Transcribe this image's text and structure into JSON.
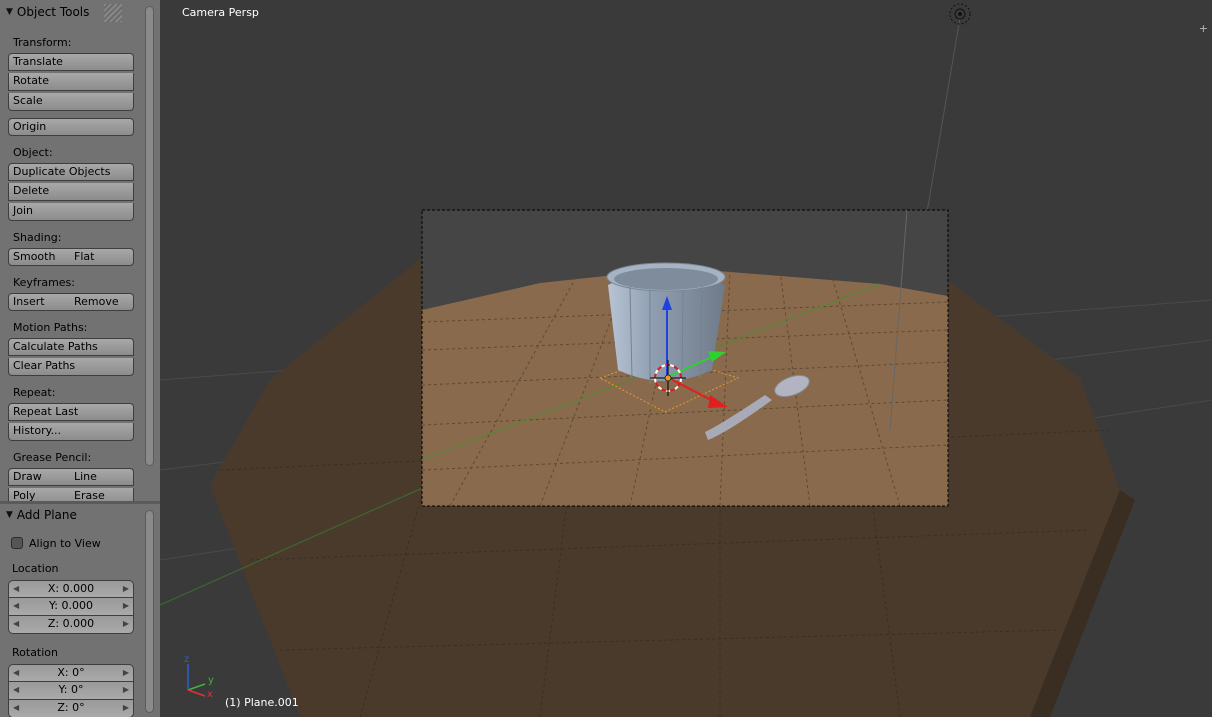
{
  "tool_shelf": {
    "object_tools_title": "Object Tools",
    "transform_label": "Transform:",
    "translate": "Translate",
    "rotate": "Rotate",
    "scale": "Scale",
    "origin": "Origin",
    "object_label": "Object:",
    "duplicate_objects": "Duplicate Objects",
    "delete": "Delete",
    "join": "Join",
    "shading_label": "Shading:",
    "smooth": "Smooth",
    "flat": "Flat",
    "keyframes_label": "Keyframes:",
    "insert": "Insert",
    "remove": "Remove",
    "motion_paths_label": "Motion Paths:",
    "calculate_paths": "Calculate Paths",
    "clear_paths": "Clear Paths",
    "repeat_label": "Repeat:",
    "repeat_last": "Repeat Last",
    "history": "History...",
    "grease_pencil_label": "Grease Pencil:",
    "draw": "Draw",
    "line": "Line",
    "poly": "Poly",
    "erase": "Erase"
  },
  "operator_panel": {
    "title": "Add Plane",
    "align_to_view": "Align to View",
    "align_to_view_checked": false,
    "location_label": "Location",
    "loc_x": "X: 0.000",
    "loc_y": "Y: 0.000",
    "loc_z": "Z: 0.000",
    "rotation_label": "Rotation",
    "rot_x": "X: 0°",
    "rot_y": "Y: 0°",
    "rot_z": "Z: 0°"
  },
  "viewport": {
    "view_name": "Camera Persp",
    "active_object": "(1) Plane.001",
    "axis_x": "x",
    "axis_y": "y",
    "axis_z": "z"
  },
  "colors": {
    "floor_outer": "#4a3a2b",
    "floor_inner": "#8a6a4c",
    "cup": "#8e9db0",
    "spoon": "#a9aab8",
    "selection": "#e89a2c",
    "axis_x": "#e02020",
    "axis_y": "#30d030",
    "axis_z": "#2040e0"
  }
}
